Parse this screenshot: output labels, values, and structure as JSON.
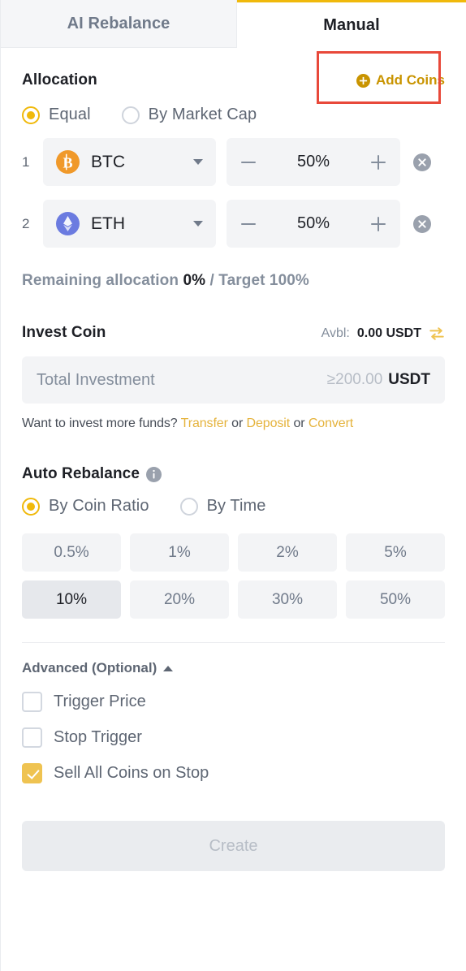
{
  "tabs": [
    {
      "label": "AI Rebalance",
      "active": false
    },
    {
      "label": "Manual",
      "active": true
    }
  ],
  "allocation": {
    "title": "Allocation",
    "add_coins_label": "Add Coins",
    "add_coins_icon": "plus-circle-icon",
    "highlight_color": "#e8493a",
    "modes": [
      {
        "label": "Equal",
        "selected": true
      },
      {
        "label": "By Market Cap",
        "selected": false
      }
    ],
    "coins": [
      {
        "index": "1",
        "symbol": "BTC",
        "icon": "bitcoin-icon",
        "icon_color": "#f0992a",
        "percent": "50%"
      },
      {
        "index": "2",
        "symbol": "ETH",
        "icon": "ethereum-icon",
        "icon_color": "#6b7be0",
        "percent": "50%"
      }
    ],
    "remaining_prefix": "Remaining allocation ",
    "remaining_value": "0%",
    "remaining_suffix": " / Target 100%"
  },
  "invest": {
    "title": "Invest Coin",
    "avbl_label": "Avbl:",
    "avbl_value": "0.00 USDT",
    "swap_icon": "swap-icon",
    "input_placeholder": "Total Investment",
    "input_min": "≥200.00",
    "input_unit": "USDT",
    "more_funds_text": "Want to invest more funds?",
    "link_transfer": "Transfer",
    "or_1": " or ",
    "link_deposit": "Deposit",
    "or_2": " or ",
    "link_convert": "Convert"
  },
  "auto_rebalance": {
    "title": "Auto Rebalance",
    "info_icon": "info-icon",
    "modes": [
      {
        "label": "By Coin Ratio",
        "selected": true
      },
      {
        "label": "By Time",
        "selected": false
      }
    ],
    "thresholds": [
      {
        "label": "0.5%",
        "selected": false
      },
      {
        "label": "1%",
        "selected": false
      },
      {
        "label": "2%",
        "selected": false
      },
      {
        "label": "5%",
        "selected": false
      },
      {
        "label": "10%",
        "selected": true
      },
      {
        "label": "20%",
        "selected": false
      },
      {
        "label": "30%",
        "selected": false
      },
      {
        "label": "50%",
        "selected": false
      }
    ]
  },
  "advanced": {
    "title": "Advanced (Optional)",
    "chevron_icon": "chevron-up-icon",
    "options": [
      {
        "label": "Trigger Price",
        "checked": false
      },
      {
        "label": "Stop Trigger",
        "checked": false
      },
      {
        "label": "Sell All Coins on Stop",
        "checked": true
      }
    ]
  },
  "footer": {
    "create_label": "Create"
  },
  "colors": {
    "accent": "#f0b90b",
    "link": "#e5b33c",
    "highlight": "#e8493a",
    "text_primary": "#1e2026",
    "text_secondary": "#5e6673",
    "text_muted": "#848e9c",
    "surface": "#f3f4f6"
  }
}
